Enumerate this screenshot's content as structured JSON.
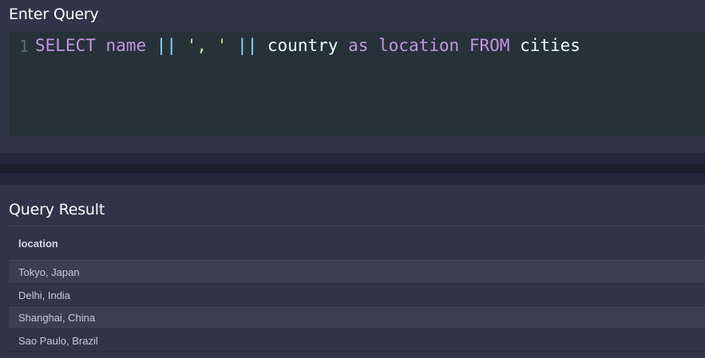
{
  "query_panel": {
    "title": "Enter Query",
    "line_number": "1",
    "code_tokens": [
      {
        "text": "SELECT",
        "type": "kw"
      },
      {
        "text": " ",
        "type": "plain"
      },
      {
        "text": "name",
        "type": "kw"
      },
      {
        "text": " ",
        "type": "plain"
      },
      {
        "text": "||",
        "type": "op"
      },
      {
        "text": " ",
        "type": "plain"
      },
      {
        "text": "', '",
        "type": "str"
      },
      {
        "text": " ",
        "type": "plain"
      },
      {
        "text": "||",
        "type": "op"
      },
      {
        "text": " ",
        "type": "plain"
      },
      {
        "text": "country",
        "type": "plain"
      },
      {
        "text": " ",
        "type": "plain"
      },
      {
        "text": "as",
        "type": "kw"
      },
      {
        "text": " ",
        "type": "plain"
      },
      {
        "text": "location",
        "type": "kw"
      },
      {
        "text": " ",
        "type": "plain"
      },
      {
        "text": "FROM",
        "type": "kw"
      },
      {
        "text": " ",
        "type": "plain"
      },
      {
        "text": "cities",
        "type": "plain"
      }
    ]
  },
  "result_panel": {
    "title": "Query Result",
    "columns": [
      "location"
    ],
    "rows": [
      [
        "Tokyo, Japan"
      ],
      [
        "Delhi, India"
      ],
      [
        "Shanghai, China"
      ],
      [
        "Sao Paulo, Brazil"
      ]
    ]
  },
  "colors": {
    "keyword": "#c792ea",
    "operator": "#89ddff",
    "string": "#c3e88d",
    "editor_bg": "#263238",
    "panel_bg": "#313449"
  }
}
